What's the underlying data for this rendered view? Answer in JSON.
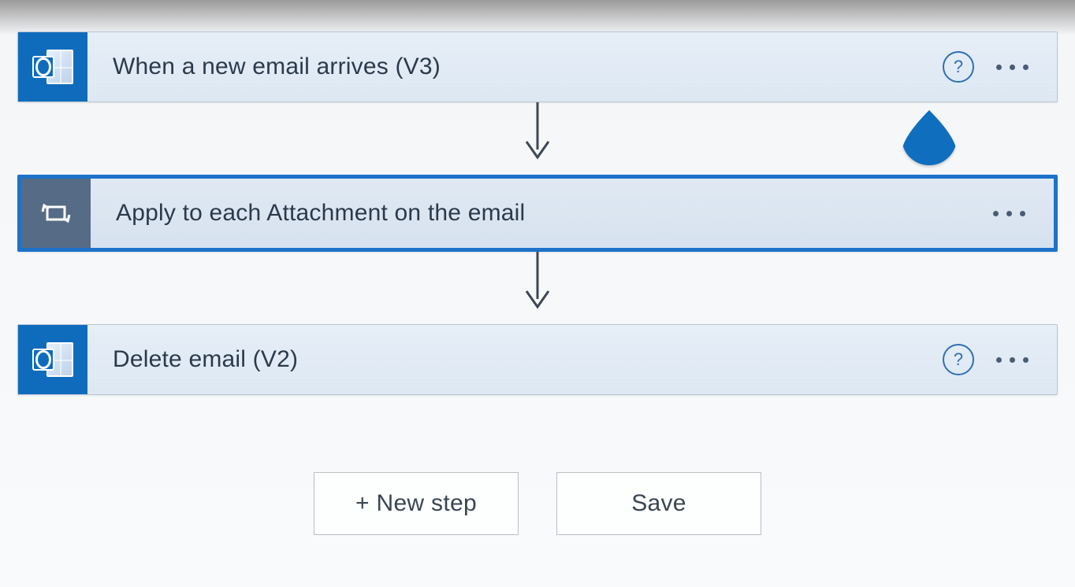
{
  "steps": [
    {
      "title": "When a new email arrives (V3)",
      "icon": "outlook",
      "hasHelp": true,
      "selected": false
    },
    {
      "title": "Apply to each Attachment on the email",
      "icon": "loop",
      "hasHelp": false,
      "selected": true
    },
    {
      "title": "Delete email (V2)",
      "icon": "outlook",
      "hasHelp": true,
      "selected": false
    }
  ],
  "footer": {
    "newStep": "+ New step",
    "save": "Save"
  }
}
